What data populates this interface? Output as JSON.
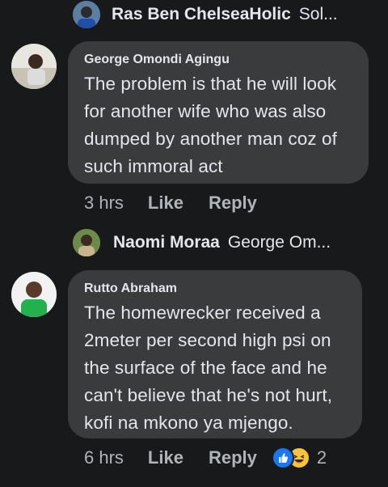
{
  "top_reply": {
    "name": "Ras Ben ChelseaHolic",
    "snippet": "Sol..."
  },
  "comments": [
    {
      "author": "George Omondi Agingu",
      "lines": [
        "The problem is that he will look",
        "for another wife who was also",
        "dumped by another man coz of",
        "such immoral act"
      ],
      "time": "3 hrs",
      "like_label": "Like",
      "reply_label": "Reply"
    },
    {
      "author": "Rutto Abraham",
      "lines": [
        "The homewrecker received a",
        "2meter per second high psi on",
        "the surface of the face and he",
        "can't believe that he's not hurt,",
        "kofi na mkono ya mjengo."
      ],
      "time": "6 hrs",
      "like_label": "Like",
      "reply_label": "Reply",
      "reactions": {
        "icons": [
          "like-icon",
          "haha-icon"
        ],
        "count": "2"
      }
    }
  ],
  "mid_reply": {
    "name": "Naomi Moraa",
    "snippet": "George Om..."
  },
  "colors": {
    "background": "#18191a",
    "bubble": "#3a3b3c",
    "text": "#e4e6eb",
    "secondary": "#b0b3b8",
    "like_blue": "#1877f2",
    "haha_yellow": "#f7c43a"
  }
}
